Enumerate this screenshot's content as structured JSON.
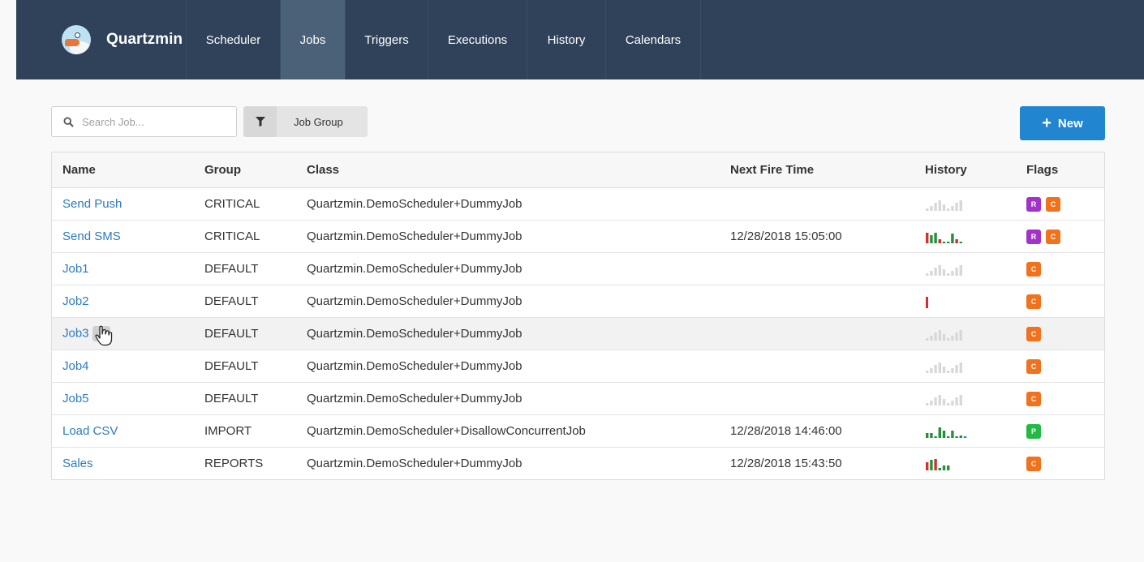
{
  "app": {
    "name": "Quartzmin",
    "nav": [
      {
        "label": "Scheduler",
        "width": 116,
        "active": false
      },
      {
        "label": "Jobs",
        "width": 80,
        "active": true
      },
      {
        "label": "Triggers",
        "width": 102,
        "active": false
      },
      {
        "label": "Executions",
        "width": 122,
        "active": false
      },
      {
        "label": "History",
        "width": 97,
        "active": false
      },
      {
        "label": "Calendars",
        "width": 117,
        "active": false
      }
    ]
  },
  "toolbar": {
    "search_placeholder": "Search Job...",
    "filter_label": "Job Group",
    "new_label": "New"
  },
  "table": {
    "headers": {
      "name": "Name",
      "group": "Group",
      "class": "Class",
      "next_fire_time": "Next Fire Time",
      "history": "History",
      "flags": "Flags"
    },
    "rows": [
      {
        "name": "Send Push",
        "group": "CRITICAL",
        "class": "Quartzmin.DemoScheduler+DummyJob",
        "next_fire_time": "",
        "history": "empty",
        "flags": [
          "R",
          "C"
        ]
      },
      {
        "name": "Send SMS",
        "group": "CRITICAL",
        "class": "Quartzmin.DemoScheduler+DummyJob",
        "next_fire_time": "12/28/2018 15:05:00",
        "history": "sms",
        "flags": [
          "R",
          "C"
        ]
      },
      {
        "name": "Job1",
        "group": "DEFAULT",
        "class": "Quartzmin.DemoScheduler+DummyJob",
        "next_fire_time": "",
        "history": "empty",
        "flags": [
          "C"
        ]
      },
      {
        "name": "Job2",
        "group": "DEFAULT",
        "class": "Quartzmin.DemoScheduler+DummyJob",
        "next_fire_time": "",
        "history": "single-fail",
        "flags": [
          "C"
        ]
      },
      {
        "name": "Job3",
        "group": "DEFAULT",
        "class": "Quartzmin.DemoScheduler+DummyJob",
        "next_fire_time": "",
        "history": "empty",
        "flags": [
          "C"
        ],
        "hover": true
      },
      {
        "name": "Job4",
        "group": "DEFAULT",
        "class": "Quartzmin.DemoScheduler+DummyJob",
        "next_fire_time": "",
        "history": "empty",
        "flags": [
          "C"
        ]
      },
      {
        "name": "Job5",
        "group": "DEFAULT",
        "class": "Quartzmin.DemoScheduler+DummyJob",
        "next_fire_time": "",
        "history": "empty",
        "flags": [
          "C"
        ]
      },
      {
        "name": "Load CSV",
        "group": "IMPORT",
        "class": "Quartzmin.DemoScheduler+DisallowConcurrentJob",
        "next_fire_time": "12/28/2018 14:46:00",
        "history": "csv",
        "flags": [
          "P"
        ]
      },
      {
        "name": "Sales",
        "group": "REPORTS",
        "class": "Quartzmin.DemoScheduler+DummyJob",
        "next_fire_time": "12/28/2018 15:43:50",
        "history": "sales",
        "flags": [
          "C"
        ]
      }
    ]
  },
  "history_charts": {
    "empty": [
      [
        3,
        "#d8d8d8"
      ],
      [
        6,
        "#d8d8d8"
      ],
      [
        10,
        "#d8d8d8"
      ],
      [
        13,
        "#d8d8d8"
      ],
      [
        8,
        "#d8d8d8"
      ],
      [
        3,
        "#d8d8d8"
      ],
      [
        6,
        "#d8d8d8"
      ],
      [
        10,
        "#d8d8d8"
      ],
      [
        13,
        "#d8d8d8"
      ]
    ],
    "sms": [
      [
        13,
        "#d32f2f"
      ],
      [
        10,
        "#21913a"
      ],
      [
        13,
        "#21913a"
      ],
      [
        5,
        "#d32f2f"
      ],
      [
        2,
        "#21913a"
      ],
      [
        2,
        "#21913a"
      ],
      [
        12,
        "#21913a"
      ],
      [
        5,
        "#d32f2f"
      ],
      [
        2,
        "#21913a"
      ]
    ],
    "single-fail": [
      [
        14,
        "#d32f2f"
      ]
    ],
    "csv": [
      [
        6,
        "#21913a"
      ],
      [
        6,
        "#21913a"
      ],
      [
        2,
        "#21913a"
      ],
      [
        13,
        "#21913a"
      ],
      [
        9,
        "#21913a"
      ],
      [
        2,
        "#21913a"
      ],
      [
        9,
        "#21913a"
      ],
      [
        2,
        "#21913a"
      ],
      [
        3,
        "#21913a"
      ],
      [
        2,
        "#2185d0"
      ]
    ],
    "sales": [
      [
        10,
        "#d32f2f"
      ],
      [
        13,
        "#21913a"
      ],
      [
        14,
        "#d32f2f"
      ],
      [
        3,
        "#21913a"
      ],
      [
        6,
        "#21913a"
      ],
      [
        6,
        "#21913a"
      ]
    ]
  }
}
